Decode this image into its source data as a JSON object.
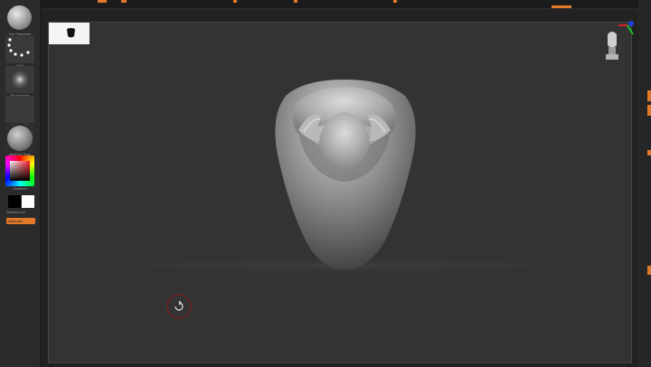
{
  "window": {
    "title": ""
  },
  "shelf": {
    "brush_label": "Dec Standard",
    "stroke_label": "Dots",
    "alpha_label": "BrushAlpha",
    "texture_label": "Texture Off",
    "material_label": "MatCap Gray",
    "gradient_label": "Gradient",
    "switch_label": "SwitchColor",
    "alternate_label": "Alternate"
  },
  "colors": {
    "accent": "#e07a2a",
    "canvas_bg": "#333333",
    "main_color": "#000000",
    "secondary_color": "#ffffff"
  },
  "icons": {
    "gizmo": "xyz-axis-gizmo-with-head-icon",
    "cursor": "rotate-cursor-icon",
    "navigator": "navigator-thumbnail"
  }
}
